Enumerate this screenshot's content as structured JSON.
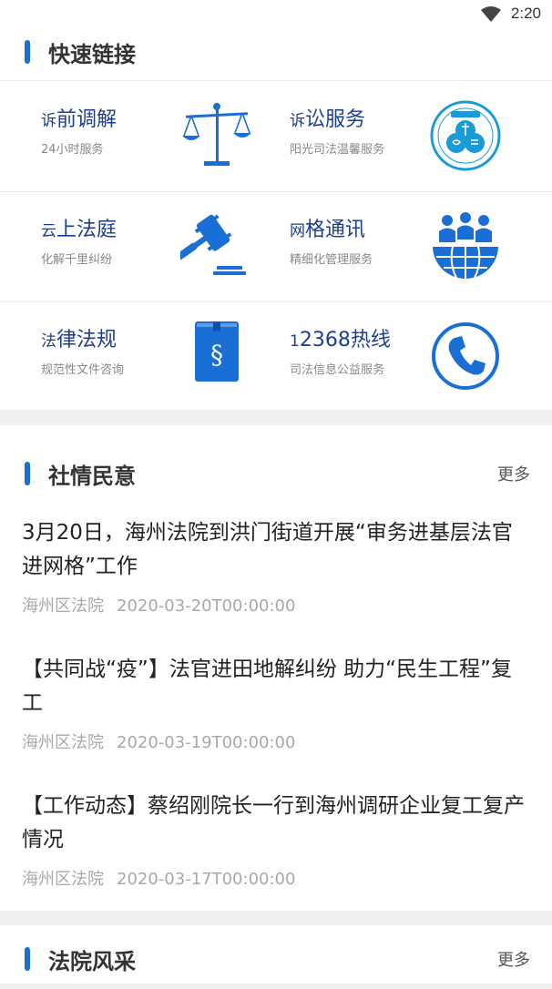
{
  "status": {
    "time": "2:20"
  },
  "quick_links": {
    "title": "快速链接",
    "items": [
      {
        "first": "诉",
        "rest": "前调解",
        "sub": "24小时服务",
        "icon": "scales-icon"
      },
      {
        "first": "诉",
        "rest": "讼服务",
        "sub": "阳光司法温馨服务",
        "icon": "litigation-service-center-logo-icon"
      },
      {
        "first": "云",
        "rest": "上法庭",
        "sub": "化解千里纠纷",
        "icon": "gavel-icon"
      },
      {
        "first": "网",
        "rest": "格通讯",
        "sub": "精细化管理服务",
        "icon": "globe-people-icon"
      },
      {
        "first": "法",
        "rest": "律法规",
        "sub": "规范性文件咨询",
        "icon": "law-book-icon"
      },
      {
        "first": "1",
        "rest": "2368热线",
        "sub": "司法信息公益服务",
        "icon": "phone-icon"
      }
    ]
  },
  "public_opinion": {
    "title": "社情民意",
    "more": "更多",
    "news": [
      {
        "headline": "3月20日，海州法院到洪门街道开展“审务进基层法官进网格”工作",
        "source": "海州区法院",
        "date": "2020-03-20T00:00:00"
      },
      {
        "headline": "【共同战“疫”】法官进田地解纠纷 助力“民生工程”复工",
        "source": "海州区法院",
        "date": "2020-03-19T00:00:00"
      },
      {
        "headline": "【工作动态】蔡绍刚院长一行到海州调研企业复工复产情况",
        "source": "海州区法院",
        "date": "2020-03-17T00:00:00"
      }
    ]
  },
  "court_style": {
    "title": "法院风采",
    "more": "更多"
  },
  "colors": {
    "accent": "#1a6fd6",
    "link_title": "#1d3f8f"
  }
}
